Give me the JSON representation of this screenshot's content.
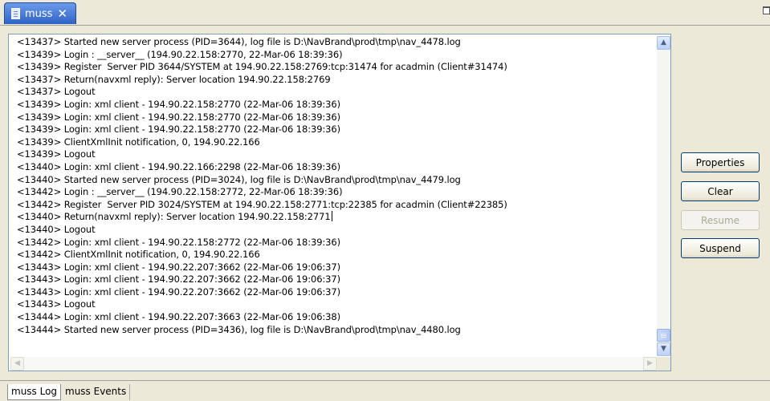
{
  "tab": {
    "title": "muss",
    "close_glyph": "✕",
    "icon": "document-icon"
  },
  "log": {
    "lines": [
      "<13437> Started new server process (PID=3644), log file is D:\\NavBrand\\prod\\tmp\\nav_4478.log",
      "<13439> Login : __server__ (194.90.22.158:2770, 22-Mar-06 18:39:36)",
      "<13439> Register  Server PID 3644/SYSTEM at 194.90.22.158:2769:tcp:31474 for acadmin (Client#31474)",
      "<13437> Return(navxml reply): Server location 194.90.22.158:2769",
      "<13437> Logout",
      "<13439> Login: xml client - 194.90.22.158:2770 (22-Mar-06 18:39:36)",
      "<13439> Login: xml client - 194.90.22.158:2770 (22-Mar-06 18:39:36)",
      "<13439> Login: xml client - 194.90.22.158:2770 (22-Mar-06 18:39:36)",
      "<13439> ClientXmlInit notification, 0, 194.90.22.166",
      "<13439> Logout",
      "<13440> Login: xml client - 194.90.22.166:2298 (22-Mar-06 18:39:36)",
      "<13440> Started new server process (PID=3024), log file is D:\\NavBrand\\prod\\tmp\\nav_4479.log",
      "<13442> Login : __server__ (194.90.22.158:2772, 22-Mar-06 18:39:36)",
      "<13442> Register  Server PID 3024/SYSTEM at 194.90.22.158:2771:tcp:22385 for acadmin (Client#22385)",
      "<13440> Return(navxml reply): Server location 194.90.22.158:2771",
      "<13440> Logout",
      "<13442> Login: xml client - 194.90.22.158:2772 (22-Mar-06 18:39:36)",
      "<13442> ClientXmlInit notification, 0, 194.90.22.166",
      "<13443> Login: xml client - 194.90.22.207:3662 (22-Mar-06 19:06:37)",
      "<13443> Login: xml client - 194.90.22.207:3662 (22-Mar-06 19:06:37)",
      "<13443> Login: xml client - 194.90.22.207:3662 (22-Mar-06 19:06:37)",
      "<13443> Logout",
      "<13444> Login: xml client - 194.90.22.207:3663 (22-Mar-06 19:06:38)",
      "<13444> Started new server process (PID=3436), log file is D:\\NavBrand\\prod\\tmp\\nav_4480.log"
    ],
    "caret_line": 14
  },
  "buttons": {
    "properties": "Properties",
    "clear": "Clear",
    "resume": "Resume",
    "suspend": "Suspend"
  },
  "bottom_tabs": {
    "log": "muss Log",
    "events": "muss Events"
  },
  "scrollbar_glyphs": {
    "up": "▲",
    "down": "▼",
    "left": "◀",
    "right": "▶"
  }
}
